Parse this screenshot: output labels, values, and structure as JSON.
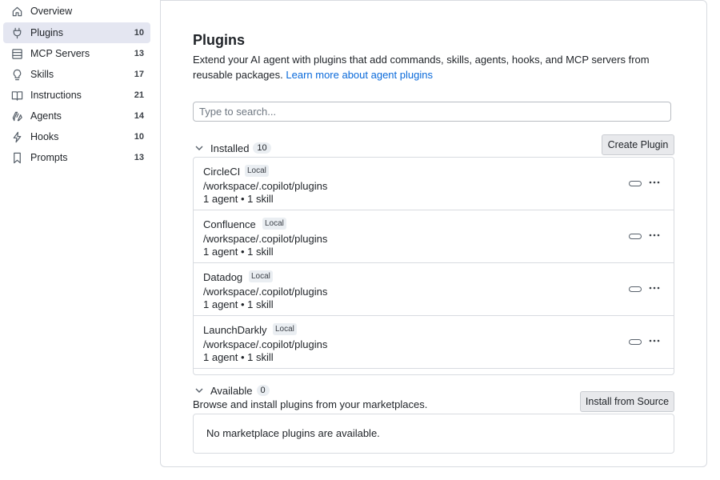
{
  "sidebar": {
    "items": [
      {
        "label": "Overview",
        "count": "",
        "icon": "home-icon"
      },
      {
        "label": "Plugins",
        "count": "10",
        "icon": "plug-icon",
        "active": true
      },
      {
        "label": "MCP Servers",
        "count": "13",
        "icon": "server-icon"
      },
      {
        "label": "Skills",
        "count": "17",
        "icon": "lightbulb-icon"
      },
      {
        "label": "Instructions",
        "count": "21",
        "icon": "book-icon"
      },
      {
        "label": "Agents",
        "count": "14",
        "icon": "agent-icon"
      },
      {
        "label": "Hooks",
        "count": "10",
        "icon": "lightning-icon"
      },
      {
        "label": "Prompts",
        "count": "13",
        "icon": "bookmark-icon"
      }
    ]
  },
  "main": {
    "title": "Plugins",
    "description": "Extend your AI agent with plugins that add commands, skills, agents, hooks, and MCP servers from reusable packages.",
    "learn_more": "Learn more about agent plugins",
    "search_placeholder": "Type to search...",
    "installed": {
      "title": "Installed",
      "count": "10",
      "create_button": "Create Plugin",
      "plugins": [
        {
          "name": "CircleCI",
          "tag": "Local",
          "path": "/workspace/.copilot/plugins",
          "meta": "1 agent • 1 skill"
        },
        {
          "name": "Confluence",
          "tag": "Local",
          "path": "/workspace/.copilot/plugins",
          "meta": "1 agent • 1 skill"
        },
        {
          "name": "Datadog",
          "tag": "Local",
          "path": "/workspace/.copilot/plugins",
          "meta": "1 agent • 1 skill"
        },
        {
          "name": "LaunchDarkly",
          "tag": "Local",
          "path": "/workspace/.copilot/plugins",
          "meta": "1 agent • 1 skill"
        }
      ]
    },
    "available": {
      "title": "Available",
      "count": "0",
      "install_button": "Install from Source",
      "description": "Browse and install plugins from your marketplaces.",
      "empty": "No marketplace plugins are available."
    }
  },
  "colors": {
    "accent": "#0969da",
    "active_bg": "#e4e6f1",
    "border": "#d8dbe0"
  }
}
